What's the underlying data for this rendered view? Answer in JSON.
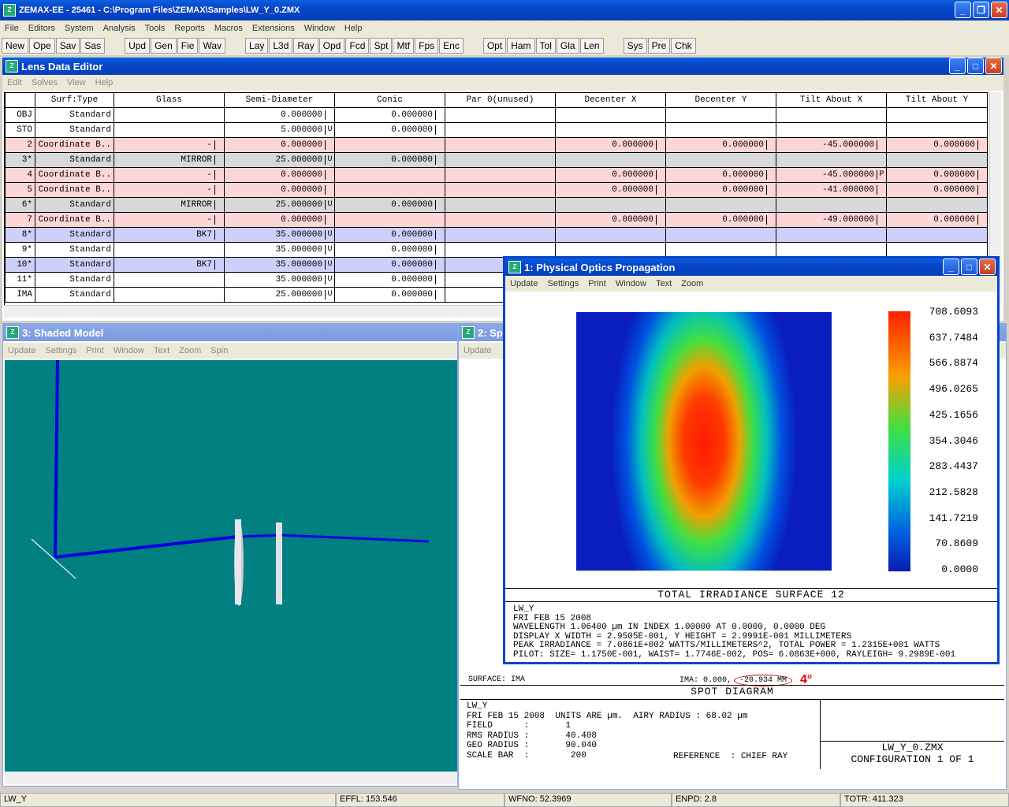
{
  "app": {
    "title": "ZEMAX-EE - 25461 - C:\\Program Files\\ZEMAX\\Samples\\LW_Y_0.ZMX"
  },
  "menu": [
    "File",
    "Editors",
    "System",
    "Analysis",
    "Tools",
    "Reports",
    "Macros",
    "Extensions",
    "Window",
    "Help"
  ],
  "toolbar": {
    "g1": [
      "New",
      "Ope",
      "Sav",
      "Sas"
    ],
    "g2": [
      "Upd",
      "Gen",
      "Fie",
      "Wav"
    ],
    "g3": [
      "Lay",
      "L3d",
      "Ray",
      "Opd",
      "Fcd",
      "Spt",
      "Mtf",
      "Fps",
      "Enc"
    ],
    "g4": [
      "Opt",
      "Ham",
      "Tol",
      "Gla",
      "Len"
    ],
    "g5": [
      "Sys",
      "Pre",
      "Chk"
    ]
  },
  "lde": {
    "title": "Lens Data Editor",
    "menu": [
      "Edit",
      "Solves",
      "View",
      "Help"
    ],
    "columns": [
      "Surf:Type",
      "Glass",
      "Semi-Diameter",
      "Conic",
      "Par 0(unused)",
      "Decenter X",
      "Decenter Y",
      "Tilt About X",
      "Tilt About Y"
    ],
    "rows": [
      {
        "s": "OBJ",
        "t": "Standard",
        "g": "",
        "sd": "0.000000",
        "su": "",
        "c": "0.000000",
        "dx": "",
        "dy": "",
        "tx": "",
        "tf": "",
        "ty": "",
        "k": ""
      },
      {
        "s": "STO",
        "t": "Standard",
        "g": "",
        "sd": "5.000000",
        "su": "U",
        "c": "0.000000",
        "dx": "",
        "dy": "",
        "tx": "",
        "tf": "",
        "ty": "",
        "k": ""
      },
      {
        "s": "2",
        "t": "Coordinate B..",
        "g": "-",
        "sd": "0.000000",
        "su": "",
        "c": "",
        "dx": "0.000000",
        "dy": "0.000000",
        "tx": "-45.000000",
        "tf": "",
        "ty": "0.000000",
        "k": "pink"
      },
      {
        "s": "3*",
        "t": "Standard",
        "g": "MIRROR",
        "sd": "25.000000",
        "su": "U",
        "c": "0.000000",
        "dx": "",
        "dy": "",
        "tx": "",
        "tf": "",
        "ty": "",
        "k": "gray"
      },
      {
        "s": "4",
        "t": "Coordinate B..",
        "g": "-",
        "sd": "0.000000",
        "su": "",
        "c": "",
        "dx": "0.000000",
        "dy": "0.000000",
        "tx": "-45.000000",
        "tf": "P",
        "ty": "0.000000",
        "k": "pink"
      },
      {
        "s": "5",
        "t": "Coordinate B..",
        "g": "-",
        "sd": "0.000000",
        "su": "",
        "c": "",
        "dx": "0.000000",
        "dy": "0.000000",
        "tx": "-41.000000",
        "tf": "",
        "ty": "0.000000",
        "k": "pink"
      },
      {
        "s": "6*",
        "t": "Standard",
        "g": "MIRROR",
        "sd": "25.000000",
        "su": "U",
        "c": "0.000000",
        "dx": "",
        "dy": "",
        "tx": "",
        "tf": "",
        "ty": "",
        "k": "gray"
      },
      {
        "s": "7",
        "t": "Coordinate B..",
        "g": "-",
        "sd": "0.000000",
        "su": "",
        "c": "",
        "dx": "0.000000",
        "dy": "0.000000",
        "tx": "-49.000000",
        "tf": "",
        "ty": "0.000000",
        "k": "pink"
      },
      {
        "s": "8*",
        "t": "Standard",
        "g": "BK7",
        "sd": "35.000000",
        "su": "U",
        "c": "0.000000",
        "dx": "",
        "dy": "",
        "tx": "",
        "tf": "",
        "ty": "",
        "k": "blue"
      },
      {
        "s": "9*",
        "t": "Standard",
        "g": "",
        "sd": "35.000000",
        "su": "U",
        "c": "0.000000",
        "dx": "",
        "dy": "",
        "tx": "",
        "tf": "",
        "ty": "",
        "k": ""
      },
      {
        "s": "10*",
        "t": "Standard",
        "g": "BK7",
        "sd": "35.000000",
        "su": "U",
        "c": "0.000000",
        "dx": "",
        "dy": "",
        "tx": "",
        "tf": "",
        "ty": "",
        "k": "blue"
      },
      {
        "s": "11*",
        "t": "Standard",
        "g": "",
        "sd": "35.000000",
        "su": "U",
        "c": "0.000000",
        "dx": "",
        "dy": "",
        "tx": "",
        "tf": "",
        "ty": "",
        "k": ""
      },
      {
        "s": "IMA",
        "t": "Standard",
        "g": "",
        "sd": "25.000000",
        "su": "U",
        "c": "0.000000",
        "dx": "",
        "dy": "",
        "tx": "",
        "tf": "",
        "ty": "",
        "k": ""
      }
    ]
  },
  "shaded": {
    "title": "3: Shaded Model",
    "menu": [
      "Update",
      "Settings",
      "Print",
      "Window",
      "Text",
      "Zoom",
      "Spin"
    ],
    "bg": "#008080"
  },
  "spot": {
    "title": "2: Sp",
    "menu": [
      "Update"
    ],
    "surface": "SURFACE: IMA",
    "ima_prefix": "IMA: 0.000,",
    "ima_value": "-20.934 MM",
    "annotation": "4°",
    "caption": "SPOT DIAGRAM",
    "info": [
      "LW_Y",
      "FRI FEB 15 2008  UNITS ARE µm.  AIRY RADIUS : 68.02 µm",
      "FIELD      :       1",
      "RMS RADIUS :       40.408",
      "GEO RADIUS :       90.040",
      "SCALE BAR  :        200"
    ],
    "reference": "REFERENCE  : CHIEF RAY",
    "file": "LW_Y_0.ZMX",
    "config": "CONFIGURATION  1  OF  1"
  },
  "pop": {
    "title": "1: Physical Optics Propagation",
    "menu": [
      "Update",
      "Settings",
      "Print",
      "Window",
      "Text",
      "Zoom"
    ],
    "scale": [
      "708.6093",
      "637.7484",
      "566.8874",
      "496.0265",
      "425.1656",
      "354.3046",
      "283.4437",
      "212.5828",
      "141.7219",
      "70.8609",
      "0.0000"
    ],
    "caption": "TOTAL IRRADIANCE SURFACE 12",
    "info": [
      "LW_Y",
      "FRI FEB 15 2008",
      "WAVELENGTH 1.06400 µm IN INDEX 1.00000 AT 0.0000, 0.0000 DEG",
      "DISPLAY X WIDTH = 2.9505E-001, Y HEIGHT = 2.9991E-001 MILLIMETERS",
      "PEAK IRRADIANCE = 7.0861E+002 WATTS/MILLIMETERS^2, TOTAL POWER = 1.2315E+001 WATTS",
      "PILOT: SIZE= 1.1750E-001, WAIST= 1.7746E-002, POS= 6.0863E+000, RAYLEIGH= 9.2989E-001"
    ]
  },
  "status": [
    "LW_Y",
    "EFFL: 153.546",
    "WFNO: 52.3969",
    "ENPD: 2.8",
    "TOTR: 411.323"
  ]
}
